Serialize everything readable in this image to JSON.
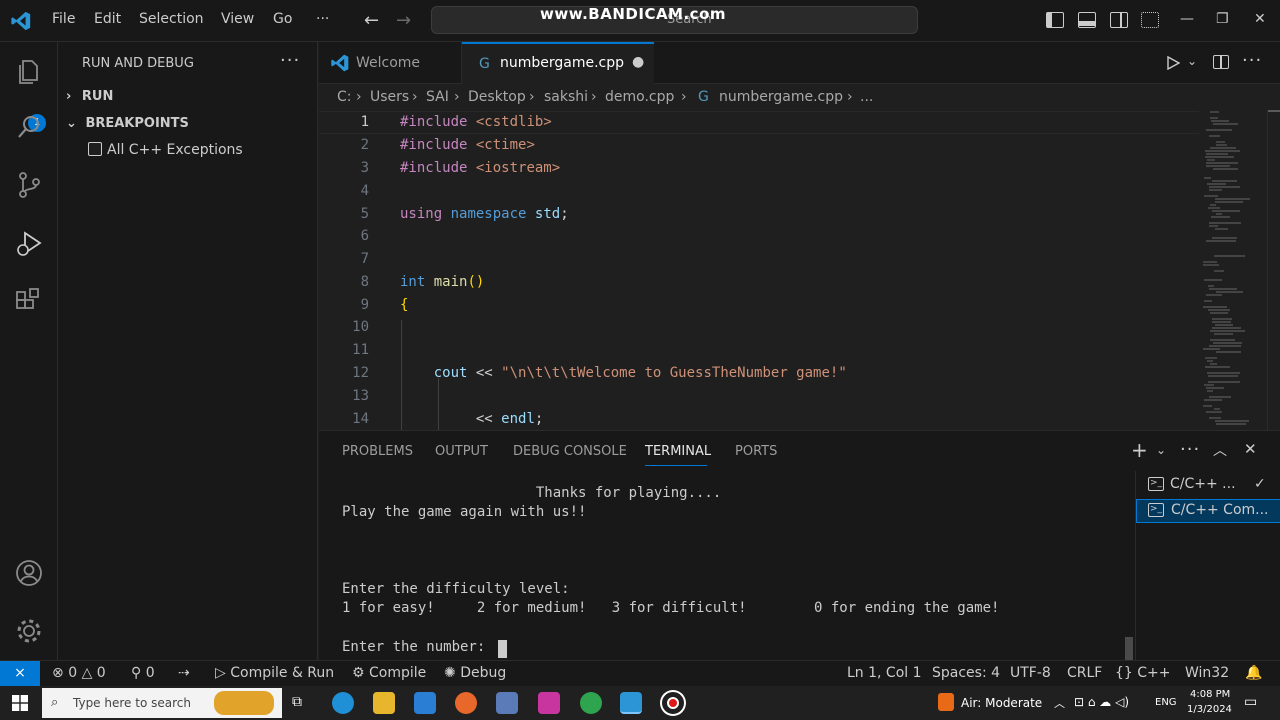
{
  "watermark": "www.BANDICAM.com",
  "menu": {
    "file": "File",
    "edit": "Edit",
    "selection": "Selection",
    "view": "View",
    "go": "Go",
    "more": "···"
  },
  "search": {
    "placeholder": "Search"
  },
  "activity": {
    "badge": "1"
  },
  "sidebar": {
    "title": "RUN AND DEBUG",
    "more": "···",
    "run_section": "RUN",
    "breakpoints_section": "BREAKPOINTS",
    "breakpoint_item": "All C++ Exceptions"
  },
  "tabs": [
    {
      "label": "Welcome"
    },
    {
      "label": "numbergame.cpp",
      "dirty_marker": "●"
    }
  ],
  "breadcrumb": [
    "C:",
    "Users",
    "SAI",
    "Desktop",
    "sakshi",
    "demo.cpp",
    "numbergame.cpp",
    "..."
  ],
  "editor": {
    "line_numbers": [
      "1",
      "2",
      "3",
      "4",
      "5",
      "6",
      "7",
      "8",
      "9",
      "10",
      "11",
      "12",
      "13",
      "14"
    ],
    "lines": {
      "l1_kw": "#include",
      "l1_arg": "<cstdlib>",
      "l2_kw": "#include",
      "l2_arg": "<ctime>",
      "l3_kw": "#include",
      "l3_arg": "<iostream>",
      "l5_using": "using",
      "l5_ns": "namespace",
      "l5_std": "std",
      "l8_int": "int",
      "l8_main": "main",
      "l12_cout": "cout",
      "l12_op": "<<",
      "l12_str": "\"\\n\\t\\t\\tWelcome to GuessTheNumber game!\"",
      "l14_op": "<<",
      "l14_endl": "endl"
    }
  },
  "panel": {
    "tabs": [
      "PROBLEMS",
      "OUTPUT",
      "DEBUG CONSOLE",
      "TERMINAL",
      "PORTS"
    ],
    "terminal_lines": [
      "                       Thanks for playing....",
      "Play the game again with us!!",
      "Enter the difficulty level:",
      "1 for easy!     2 for medium!   3 for difficult!        0 for ending the game!",
      "Enter the number: "
    ],
    "terminals": [
      "C/C++ ...",
      "C/C++ Com..."
    ]
  },
  "statusbar": {
    "errors": "0",
    "warnings": "0",
    "ports": "0",
    "compile_run": "Compile & Run",
    "compile": "Compile",
    "debug": "Debug",
    "position": "Ln 1, Col 1",
    "spaces": "Spaces: 4",
    "encoding": "UTF-8",
    "eol": "CRLF",
    "language": "C++",
    "platform": "Win32"
  },
  "taskbar": {
    "search_placeholder": "Type here to search",
    "weather": "Air: Moderate",
    "lang": "ENG",
    "time": "4:08 PM",
    "date": "1/3/2024"
  },
  "colors": {
    "accent": "#0078d4",
    "editor_bg": "#1f1f1f",
    "chrome_bg": "#181818"
  }
}
